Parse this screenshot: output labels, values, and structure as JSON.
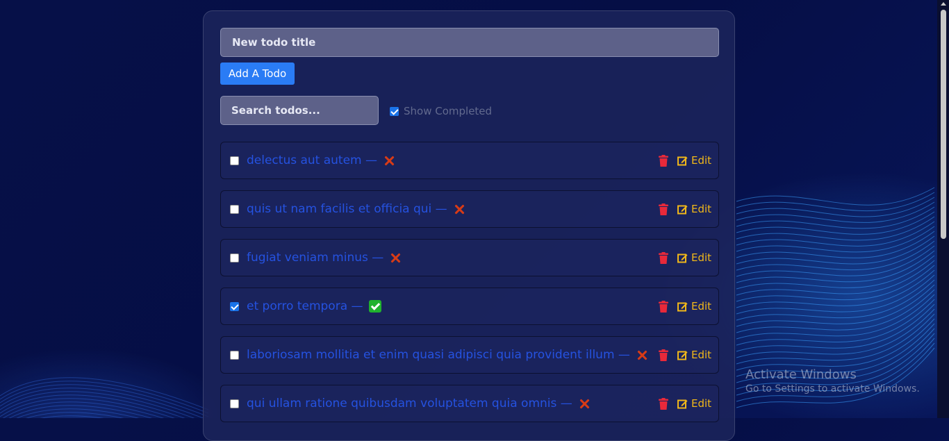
{
  "new_todo": {
    "placeholder": "New todo title",
    "button_label": "Add A Todo"
  },
  "filters": {
    "search_placeholder": "Search todos...",
    "show_completed_label": "Show Completed",
    "show_completed_checked": true
  },
  "todos": [
    {
      "title": "delectus aut autem —",
      "completed": false,
      "status_icon": "cross-mark-icon",
      "edit_label": "Edit"
    },
    {
      "title": "quis ut nam facilis et officia qui —",
      "completed": false,
      "status_icon": "cross-mark-icon",
      "edit_label": "Edit"
    },
    {
      "title": "fugiat veniam minus —",
      "completed": false,
      "status_icon": "cross-mark-icon",
      "edit_label": "Edit"
    },
    {
      "title": "et porro tempora —",
      "completed": true,
      "status_icon": "check-mark-icon",
      "edit_label": "Edit"
    },
    {
      "title": "laboriosam mollitia et enim quasi adipisci quia provident illum —",
      "completed": false,
      "status_icon": "cross-mark-icon",
      "edit_label": "Edit"
    },
    {
      "title": "qui ullam ratione quibusdam voluptatem quia omnis —",
      "completed": false,
      "status_icon": "cross-mark-icon",
      "edit_label": "Edit"
    }
  ],
  "watermark": {
    "title": "Activate Windows",
    "subtitle": "Go to Settings to activate Windows."
  },
  "colors": {
    "accent": "#2a7cf5",
    "todo_text": "#2552e0",
    "delete": "#e8293a",
    "edit": "#f0b71a",
    "done": "#20b22e",
    "not_done": "#d83b16"
  }
}
